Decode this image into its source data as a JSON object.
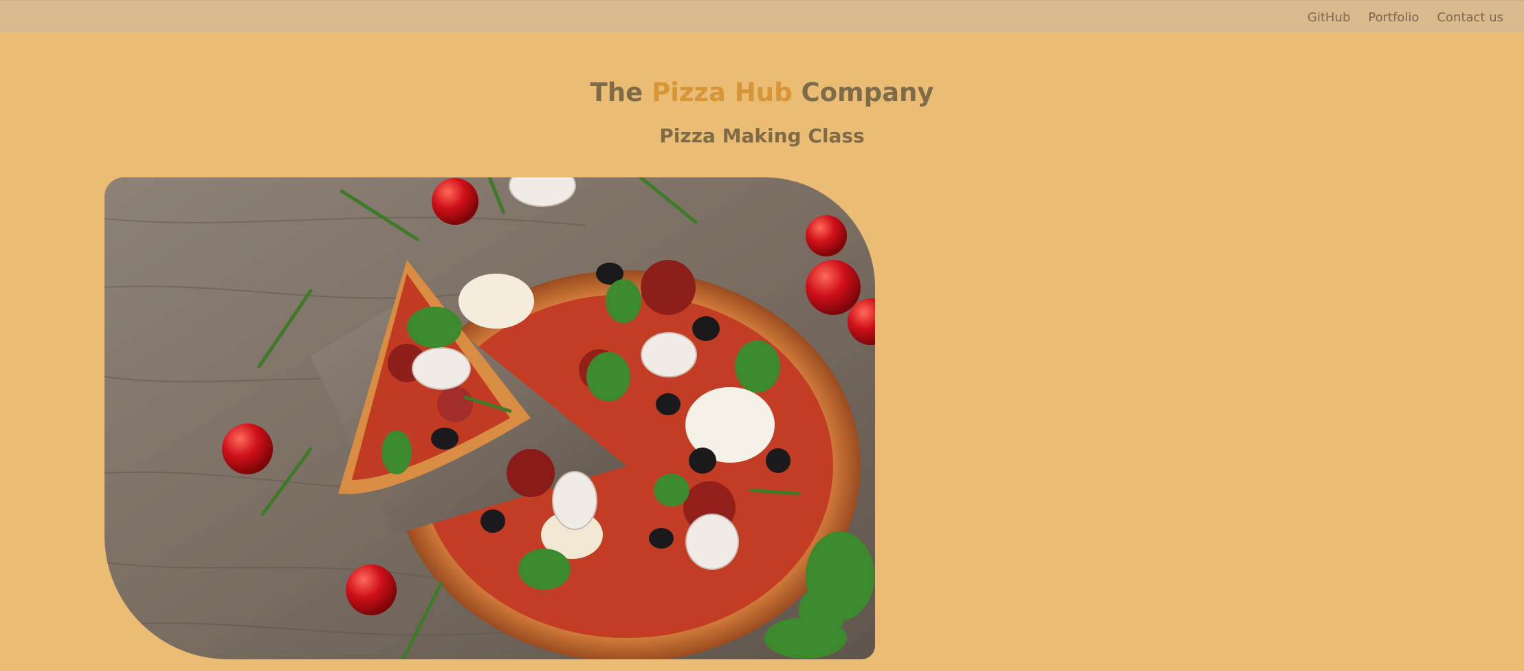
{
  "nav": {
    "items": [
      "GitHub",
      "Portfolio",
      "Contact us"
    ]
  },
  "header": {
    "title_prefix": "The",
    "title_accent": "Pizza Hub",
    "title_suffix": "Company",
    "subtitle": "Pizza Making Class"
  },
  "colors": {
    "background": "#ebbc74",
    "topbar": "#d9b98e",
    "text": "#7f6b48",
    "accent": "#d69537"
  },
  "hero": {
    "image": "pizza-photo"
  }
}
